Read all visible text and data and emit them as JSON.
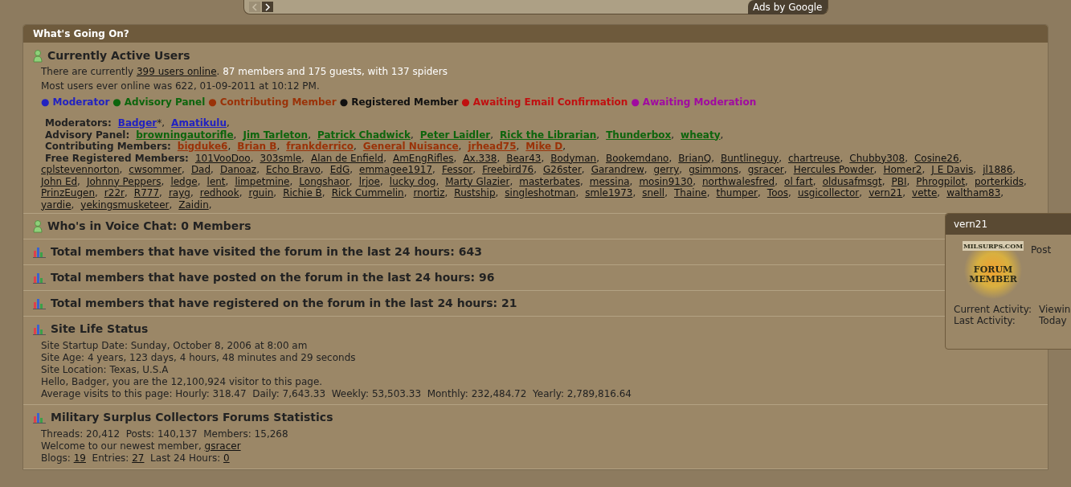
{
  "ad_bar": {
    "label": "Ads by Google"
  },
  "panel": {
    "title": "What's Going On?"
  },
  "active_users": {
    "title": "Currently Active Users",
    "lines": [
      [
        {
          "text": "There are currently ",
          "kind": "plain"
        },
        {
          "text": "399 users online",
          "kind": "link"
        },
        {
          "text": ".",
          "kind": "plain"
        },
        {
          "text": " 87 members and 175 guests, with 137 spiders",
          "kind": "highlight"
        }
      ],
      [
        {
          "text": "Most users ever online was 622, 01-09-2011 at 10:12 PM.",
          "kind": "plain"
        }
      ]
    ],
    "legend": [
      {
        "bullet": "●",
        "label": "Moderator",
        "color": "#2222c0"
      },
      {
        "bullet": "●",
        "label": "Advisory Panel",
        "color": "#0d650d"
      },
      {
        "bullet": "●",
        "label": "Contributing Member",
        "color": "#9a3208"
      },
      {
        "bullet": "●",
        "label": "Registered Member",
        "color": "#111111"
      },
      {
        "bullet": "●",
        "label": "Awaiting Email Confirmation",
        "color": "#c01010"
      },
      {
        "bullet": "●",
        "label": "Awaiting Moderation",
        "color": "#a00aa0"
      }
    ],
    "groups": [
      {
        "label": "Moderators:",
        "color": "#2222c0",
        "bold": true,
        "members": [
          {
            "name": "Badger",
            "suffix": "*,"
          },
          {
            "name": "Amatikulu",
            "suffix": ","
          }
        ]
      },
      {
        "label": "Advisory Panel:",
        "color": "#0d650d",
        "bold": true,
        "members": [
          {
            "name": "browningautorifle",
            "suffix": ","
          },
          {
            "name": "Jim Tarleton",
            "suffix": ","
          },
          {
            "name": "Patrick Chadwick",
            "suffix": ","
          },
          {
            "name": "Peter Laidler",
            "suffix": ","
          },
          {
            "name": "Rick the Librarian",
            "suffix": ","
          },
          {
            "name": "Thunderbox",
            "suffix": ","
          },
          {
            "name": "wheaty",
            "suffix": ","
          }
        ]
      },
      {
        "label": "Contributing Members:",
        "color": "#9a3208",
        "bold": true,
        "members": [
          {
            "name": "bigduke6",
            "suffix": ","
          },
          {
            "name": "Brian B",
            "suffix": ","
          },
          {
            "name": "frankderrico",
            "suffix": ","
          },
          {
            "name": "General Nuisance",
            "suffix": ","
          },
          {
            "name": "jrhead75",
            "suffix": ","
          },
          {
            "name": "Mike D",
            "suffix": ","
          }
        ]
      },
      {
        "label": "Free Registered Members:",
        "color": "#111111",
        "bold": false,
        "members": [
          {
            "name": "101VooDoo",
            "suffix": ","
          },
          {
            "name": "303smle",
            "suffix": ","
          },
          {
            "name": "Alan de Enfield",
            "suffix": ","
          },
          {
            "name": "AmEngRifles",
            "suffix": ","
          },
          {
            "name": "Ax.338",
            "suffix": ","
          },
          {
            "name": "Bear43",
            "suffix": ","
          },
          {
            "name": "Bodyman",
            "suffix": ","
          },
          {
            "name": "Bookemdano",
            "suffix": ","
          },
          {
            "name": "BrianQ",
            "suffix": ","
          },
          {
            "name": "Buntlineguy",
            "suffix": ","
          },
          {
            "name": "chartreuse",
            "suffix": ","
          },
          {
            "name": "Chubby308",
            "suffix": ","
          },
          {
            "name": "Cosine26",
            "suffix": ","
          },
          {
            "name": "cplstevennorton",
            "suffix": ","
          },
          {
            "name": "cwsommer",
            "suffix": ","
          },
          {
            "name": "Dad",
            "suffix": ","
          },
          {
            "name": "Danoaz",
            "suffix": ","
          },
          {
            "name": "Echo Bravo",
            "suffix": ","
          },
          {
            "name": "EdG",
            "suffix": ","
          },
          {
            "name": "emmagee1917",
            "suffix": ","
          },
          {
            "name": "Fessor",
            "suffix": ","
          },
          {
            "name": "Freebird76",
            "suffix": ","
          },
          {
            "name": "G26ster",
            "suffix": ","
          },
          {
            "name": "Garandrew",
            "suffix": ","
          },
          {
            "name": "gerry",
            "suffix": ","
          },
          {
            "name": "gsimmons",
            "suffix": ","
          },
          {
            "name": "gsracer",
            "suffix": ","
          },
          {
            "name": "Hercules Powder",
            "suffix": ","
          },
          {
            "name": "Homer2",
            "suffix": ","
          },
          {
            "name": "J E Davis",
            "suffix": ","
          },
          {
            "name": "jl1886",
            "suffix": ","
          },
          {
            "name": "John Ed",
            "suffix": ","
          },
          {
            "name": "Johnny Peppers",
            "suffix": ","
          },
          {
            "name": "ledge",
            "suffix": ","
          },
          {
            "name": "lent",
            "suffix": ","
          },
          {
            "name": "limpetmine",
            "suffix": ","
          },
          {
            "name": "Longshaor",
            "suffix": ","
          },
          {
            "name": "lrjoe",
            "suffix": ","
          },
          {
            "name": "lucky dog",
            "suffix": ","
          },
          {
            "name": "Marty Glazier",
            "suffix": ","
          },
          {
            "name": "masterbates",
            "suffix": ","
          },
          {
            "name": "messina",
            "suffix": ","
          },
          {
            "name": "mosin9130",
            "suffix": ","
          },
          {
            "name": "northwalesfred",
            "suffix": ","
          },
          {
            "name": "ol fart",
            "suffix": ","
          },
          {
            "name": "oldusafmsgt",
            "suffix": ","
          },
          {
            "name": "PBI",
            "suffix": ","
          },
          {
            "name": "Phrogpilot",
            "suffix": ","
          },
          {
            "name": "porterkids",
            "suffix": ","
          },
          {
            "name": "PrinzEugen",
            "suffix": ","
          },
          {
            "name": "r22r",
            "suffix": ","
          },
          {
            "name": "R777",
            "suffix": ","
          },
          {
            "name": "rayg",
            "suffix": ","
          },
          {
            "name": "redhook",
            "suffix": ","
          },
          {
            "name": "rguin",
            "suffix": ","
          },
          {
            "name": "Richie B",
            "suffix": ","
          },
          {
            "name": "Rick Cummelin",
            "suffix": ","
          },
          {
            "name": "rnortiz",
            "suffix": ","
          },
          {
            "name": "Rustship",
            "suffix": ","
          },
          {
            "name": "singleshotman",
            "suffix": ","
          },
          {
            "name": "smle1973",
            "suffix": ","
          },
          {
            "name": "snell",
            "suffix": ","
          },
          {
            "name": "Thaine",
            "suffix": ","
          },
          {
            "name": "thumper",
            "suffix": ","
          },
          {
            "name": "Toos",
            "suffix": ","
          },
          {
            "name": "usgicollector",
            "suffix": ","
          },
          {
            "name": "vern21",
            "suffix": ","
          },
          {
            "name": "vette",
            "suffix": ","
          },
          {
            "name": "waltham83",
            "suffix": ","
          },
          {
            "name": "yardie",
            "suffix": ","
          },
          {
            "name": "yekingsmusketeer",
            "suffix": ","
          },
          {
            "name": "Zaidin",
            "suffix": ","
          }
        ]
      }
    ]
  },
  "sections": [
    {
      "kind": "people_heading",
      "title": "Who's in Voice Chat: 0 Members"
    },
    {
      "kind": "stat_heading",
      "title": "Total members that have visited the forum in the last 24 hours: 643"
    },
    {
      "kind": "stat_heading",
      "title": "Total members that have posted on the forum in the last 24 hours: 96"
    },
    {
      "kind": "stat_heading",
      "title": "Total members that have registered on the forum in the last 24 hours: 21"
    },
    {
      "kind": "stat_lines",
      "title": "Site Life Status",
      "lines": [
        [
          {
            "text": "Site Startup Date: Sunday, October 8, 2006 at 8:00 am",
            "kind": "plain"
          }
        ],
        [
          {
            "text": "Site Age: 4 years, 123 days, 4 hours, 48 minutes and 29 seconds",
            "kind": "plain"
          }
        ],
        [
          {
            "text": "Site Location: Texas, U.S.A",
            "kind": "plain"
          }
        ],
        [
          {
            "text": "Hello, Badger, you are the 12,100,924 visitor to this page.",
            "kind": "plain"
          }
        ],
        [
          {
            "text": "Average visits to this page: Hourly: 318.47  Daily: 7,643.33  Weekly: 53,503.33  Monthly: 232,484.72  Yearly: 2,789,816.64",
            "kind": "plain"
          }
        ]
      ]
    },
    {
      "kind": "stat_lines",
      "title": "Military Surplus Collectors Forums Statistics",
      "lines": [
        [
          {
            "text": "Threads: 20,412  Posts: 140,137  Members: 15,268",
            "kind": "plain"
          }
        ],
        [
          {
            "text": "Welcome to our newest member, ",
            "kind": "plain"
          },
          {
            "text": "gsracer",
            "kind": "link"
          }
        ],
        [
          {
            "text": "Blogs: ",
            "kind": "plain"
          },
          {
            "text": "19",
            "kind": "link"
          },
          {
            "text": "  Entries: ",
            "kind": "plain"
          },
          {
            "text": "27",
            "kind": "link"
          },
          {
            "text": "  Last 24 Hours: ",
            "kind": "plain"
          },
          {
            "text": "0",
            "kind": "link"
          }
        ]
      ]
    }
  ],
  "popup": {
    "title": "vern21",
    "badge_top": "MILSURPS.COM",
    "badge_line1": "FORUM",
    "badge_line2": "MEMBER",
    "side_label": "Post",
    "rows": [
      {
        "label": "Current Activity:",
        "value": "Viewin"
      },
      {
        "label": "Last Activity:",
        "value": "Today"
      }
    ]
  }
}
